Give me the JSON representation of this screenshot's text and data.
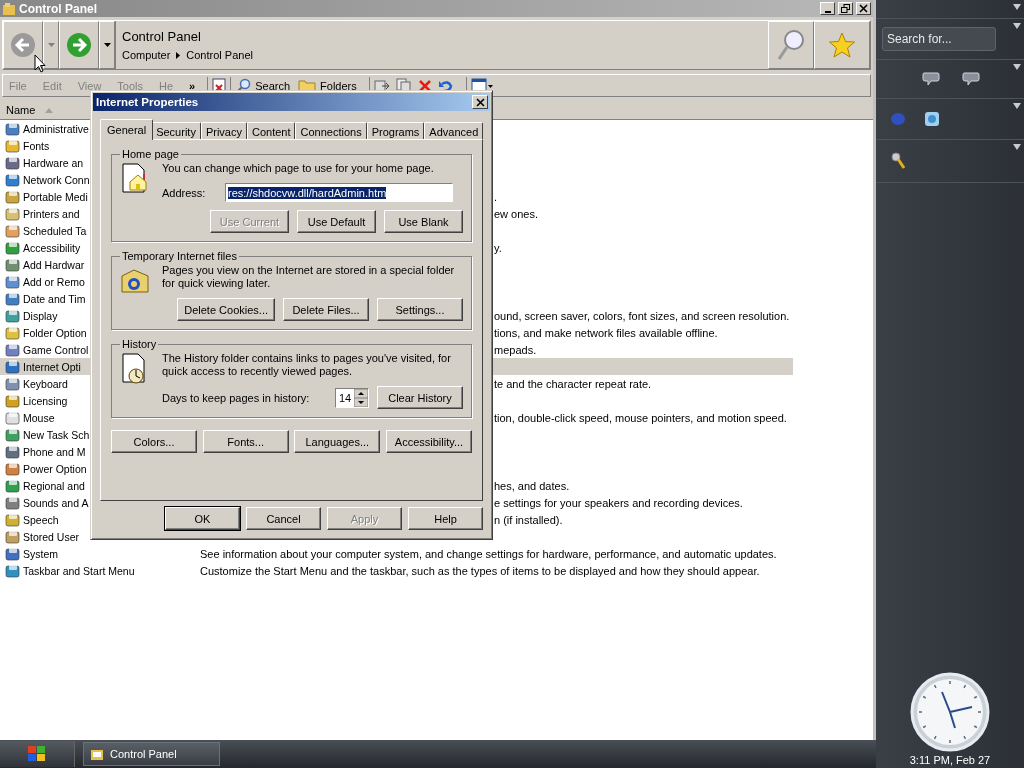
{
  "window": {
    "title": "Control Panel"
  },
  "navigation": {
    "back": {
      "disabled": true
    },
    "forward": {
      "disabled": false
    }
  },
  "address_bar": {
    "title": "Control Panel",
    "breadcrumb": [
      "Computer",
      "Control Panel"
    ]
  },
  "menu": [
    {
      "label": "File"
    },
    {
      "label": "Edit"
    },
    {
      "label": "View"
    },
    {
      "label": "Tools"
    },
    {
      "label": "He"
    }
  ],
  "menu_overflow": "»",
  "toolbar_buttons": [
    {
      "label": "Search"
    },
    {
      "label": "Folders"
    }
  ],
  "list": {
    "columns": [
      {
        "label": "Name",
        "sorted": true
      }
    ],
    "rows": [
      {
        "name": "Administrative",
        "selected": false
      },
      {
        "name": "Fonts",
        "selected": false
      },
      {
        "name": "Hardware an",
        "selected": false
      },
      {
        "name": "Network Conn",
        "selected": false
      },
      {
        "name": "Portable Medi",
        "description": ".",
        "selected": false
      },
      {
        "name": "Printers and",
        "description": "ew ones.",
        "selected": false
      },
      {
        "name": "Scheduled Ta",
        "selected": false
      },
      {
        "name": "Accessibility",
        "description": "y.",
        "selected": false
      },
      {
        "name": "Add Hardwar",
        "selected": false
      },
      {
        "name": "Add or Remo",
        "selected": false
      },
      {
        "name": "Date and Tim",
        "selected": false
      },
      {
        "name": "Display",
        "description": "ound, screen saver, colors, font sizes, and screen resolution.",
        "selected": false
      },
      {
        "name": "Folder Option",
        "description": "tions, and make network files available offline.",
        "selected": false
      },
      {
        "name": "Game Control",
        "description": "mepads.",
        "selected": false
      },
      {
        "name": "Internet Opti",
        "selected": true
      },
      {
        "name": "Keyboard",
        "description": "te and the character repeat rate.",
        "selected": false
      },
      {
        "name": "Licensing",
        "selected": false
      },
      {
        "name": "Mouse",
        "description": "tion, double-click speed, mouse pointers, and motion speed.",
        "selected": false
      },
      {
        "name": "New Task Sch",
        "selected": false
      },
      {
        "name": "Phone and M",
        "selected": false
      },
      {
        "name": "Power Option",
        "selected": false
      },
      {
        "name": "Regional and",
        "description": "hes, and dates.",
        "selected": false
      },
      {
        "name": "Sounds and A",
        "description": "e settings for your speakers and recording devices.",
        "selected": false
      },
      {
        "name": "Speech",
        "description": "n (if installed).",
        "selected": false
      },
      {
        "name": "Stored User",
        "selected": false
      },
      {
        "name": "System",
        "description": "See information about your computer system, and change settings for hardware, performance, and automatic updates.",
        "selected": false
      },
      {
        "name": "Taskbar and Start Menu",
        "description": "Customize the Start Menu and the taskbar, such as the types of items to be displayed and how they should appear.",
        "selected": false
      }
    ]
  },
  "dialog": {
    "title": "Internet Properties",
    "tabs": [
      {
        "label": "General",
        "selected": true
      },
      {
        "label": "Security",
        "selected": false
      },
      {
        "label": "Privacy",
        "selected": false
      },
      {
        "label": "Content",
        "selected": false
      },
      {
        "label": "Connections",
        "selected": false
      },
      {
        "label": "Programs",
        "selected": false
      },
      {
        "label": "Advanced",
        "selected": false
      }
    ],
    "home_page": {
      "title": "Home page",
      "text": "You can change which page to use for your home page.",
      "address_label": "Address:",
      "address": {
        "value": "res://shdocvw.dll/hardAdmin.htm",
        "selected": true
      },
      "buttons": [
        {
          "label": "Use Current",
          "disabled": true
        },
        {
          "label": "Use Default",
          "disabled": false
        },
        {
          "label": "Use Blank",
          "disabled": false
        }
      ]
    },
    "temporary_files": {
      "title": "Temporary Internet files",
      "text": "Pages you view on the Internet are stored in a special folder for quick viewing later.",
      "buttons": [
        {
          "label": "Delete Cookies...",
          "disabled": false
        },
        {
          "label": "Delete Files...",
          "disabled": false
        },
        {
          "label": "Settings...",
          "disabled": false
        }
      ]
    },
    "history": {
      "title": "History",
      "text": "The History folder contains links to pages you've visited, for quick access to recently viewed pages.",
      "days_label": "Days to keep pages in history:",
      "days": "14",
      "buttons": [
        {
          "label": "Clear History",
          "disabled": false
        }
      ]
    },
    "bottom_buttons": [
      {
        "label": "Colors...",
        "disabled": false
      },
      {
        "label": "Fonts...",
        "disabled": false
      },
      {
        "label": "Languages...",
        "disabled": false
      },
      {
        "label": "Accessibility...",
        "disabled": false
      }
    ],
    "footer_buttons": [
      {
        "label": "OK",
        "disabled": false,
        "default": true
      },
      {
        "label": "Cancel",
        "disabled": false,
        "default": false
      },
      {
        "label": "Apply",
        "disabled": true,
        "default": false
      },
      {
        "label": "Help",
        "disabled": false,
        "default": false
      }
    ]
  },
  "sidebar": {
    "search": {
      "placeholder": "Search for..."
    },
    "clock": {
      "time": "3:11 PM, Feb 27"
    }
  },
  "taskbar": {
    "tasks": [
      {
        "label": "Control Panel",
        "selected": false
      }
    ]
  }
}
